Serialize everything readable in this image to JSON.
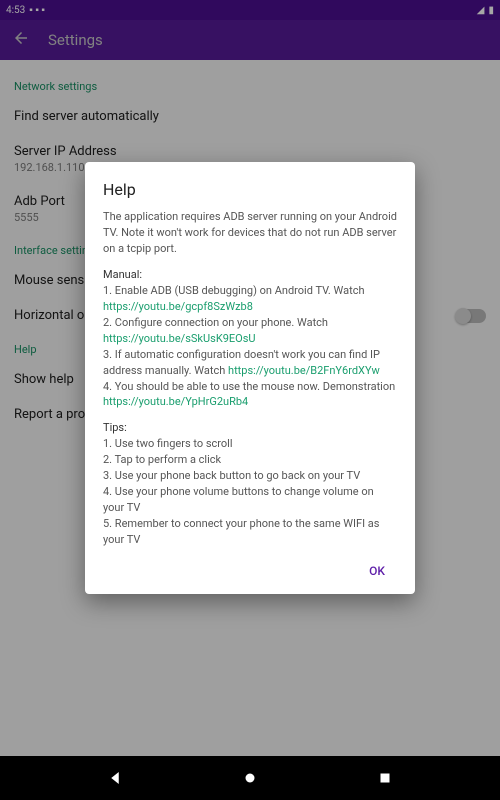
{
  "statusbar": {
    "time": "4:53",
    "signal": "▲◢",
    "battery": "▮"
  },
  "appbar": {
    "title": "Settings"
  },
  "sections": {
    "network_label": "Network settings",
    "find_server": "Find server automatically",
    "server_ip_label": "Server IP Address",
    "server_ip_value": "192.168.1.110",
    "adb_port_label": "Adb Port",
    "adb_port_value": "5555",
    "interface_label": "Interface settings",
    "mouse_sens": "Mouse sensitivity",
    "horizontal": "Horizontal orientation",
    "help_label": "Help",
    "show_help": "Show help",
    "report": "Report a problem"
  },
  "dialog": {
    "title": "Help",
    "intro": "The application requires ADB server running on your Android TV. Note it won't work for devices that do not run ADB server on a tcpip port.",
    "manual_head": "Manual:",
    "step1_a": "1. Enable ADB (USB debugging) on Android TV. Watch ",
    "link1": "https://youtu.be/gcpf8SzWzb8",
    "step2_a": "2. Configure connection on your phone. Watch ",
    "link2": "https://youtu.be/sSkUsK9EOsU",
    "step3_a": "3. If automatic configuration doesn't work you can find IP address manually. Watch ",
    "link3": "https://youtu.be/B2FnY6rdXYw",
    "step4_a": "4. You should be able to use the mouse now. Demonstration ",
    "link4": "https://youtu.be/YpHrG2uRb4",
    "tips_head": "Tips:",
    "tip1": "1. Use two fingers to scroll",
    "tip2": "2. Tap to perform a click",
    "tip3": "3. Use your phone back button to go back on your TV",
    "tip4": "4. Use your phone volume buttons to change volume on your TV",
    "tip5": "5. Remember to connect your phone to the same WIFI as your TV",
    "ok": "OK"
  }
}
